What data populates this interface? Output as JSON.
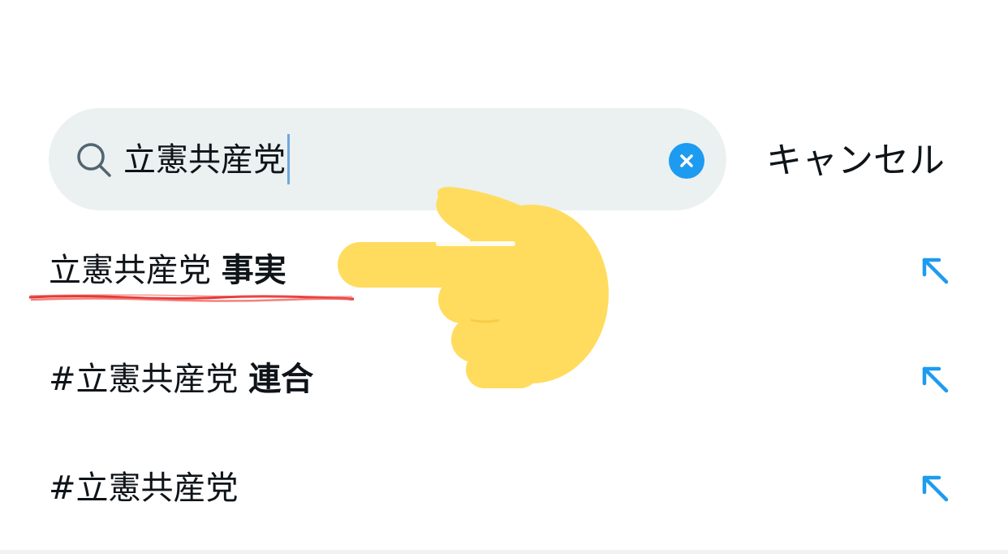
{
  "search": {
    "query": "立憲共産党",
    "cancel_label": "キャンセル"
  },
  "suggestions": [
    {
      "text": "立憲共産党",
      "bold": "事実"
    },
    {
      "text": "#立憲共産党",
      "bold": "連合"
    },
    {
      "text": "#立憲共産党",
      "bold": ""
    }
  ],
  "icons": {
    "search": "search-icon",
    "clear": "clear-icon",
    "fill_in": "arrow-up-left-icon",
    "pointer": "pointing-hand-emoji"
  },
  "colors": {
    "accent": "#1d9bf0",
    "search_bg": "#ebf0f1",
    "text": "#0f1419",
    "hand": "#ffdc5d",
    "underline": "#e53935"
  }
}
